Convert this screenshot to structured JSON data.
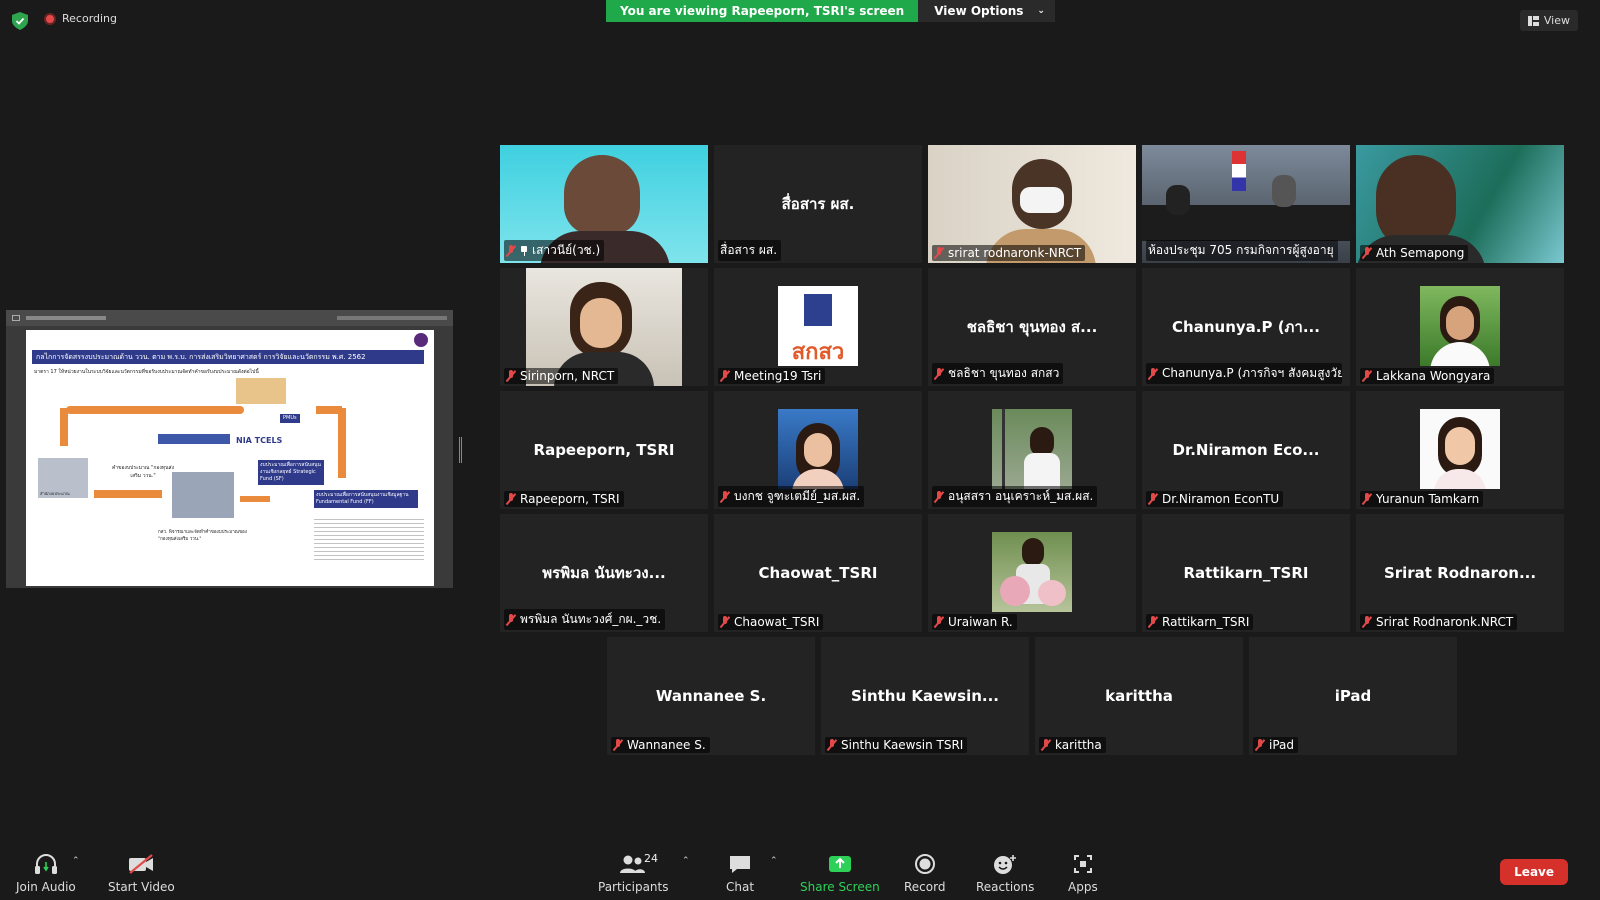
{
  "header": {
    "recording_label": "Recording",
    "viewing_banner": "You are viewing Rapeeporn, TSRI's screen",
    "view_options_label": "View Options",
    "view_label": "View"
  },
  "shared_screen": {
    "slide_title": "กลไกการจัดสรรงบประมาณด้าน ววน. ตาม พ.ร.บ. การส่งเสริมวิทยาศาสตร์ การวิจัยและนวัตกรรม พ.ศ. 2562",
    "slide_subtitle": "มาตรา 17 ให้หน่วยงานในระบบวิจัยและนวัตกรรมที่ขอรับงบประมาณจัดทำคำขอรับงบประมาณดังต่อไปนี้",
    "box_pmus": "PMUs",
    "box_sf": "งบประมาณเพื่อการสนับสนุนงานเชิงกลยุทธ์ Strategic Fund (SF)",
    "box_ff": "งบประมาณเพื่อการสนับสนุนงานเชิงมูลฐาน Fundamental Fund (FF)",
    "fund_text": "คำของบประมาณ \"กองทุนส่งเสริม ววน.\"",
    "budget_office": "สำนักงบประมาณ",
    "nia_text": "NIA TCELS",
    "bottom_text": "กสว. พิจารณาและจัดทำคำของบประมาณของ \"กองทุนส่งเสริม ววน.\""
  },
  "gallery": [
    {
      "name": "เสาวนีย์(วช.)",
      "display": "",
      "mic_muted": true,
      "pinned": true,
      "active": false,
      "video": "person-cyan"
    },
    {
      "name": "สื่อสาร ผส.",
      "display": "สื่อสาร ผส.",
      "mic_muted": false,
      "pinned": false,
      "active": false,
      "video": ""
    },
    {
      "name": "srirat rodnaronk-NRCT",
      "display": "",
      "mic_muted": true,
      "pinned": false,
      "active": false,
      "video": "person-mask"
    },
    {
      "name": "ห้องประชุม 705 กรมกิจการผู้สูงอายุ",
      "display": "",
      "mic_muted": false,
      "pinned": false,
      "active": true,
      "video": "meeting-room"
    },
    {
      "name": "Ath Semapong",
      "display": "",
      "mic_muted": true,
      "pinned": false,
      "active": false,
      "video": "person-teal"
    },
    {
      "name": "Sirinporn, NRCT",
      "display": "",
      "mic_muted": true,
      "pinned": false,
      "active": false,
      "video": "person-white"
    },
    {
      "name": "Meeting19 Tsri",
      "display": "",
      "mic_muted": true,
      "pinned": false,
      "active": false,
      "video": "logo-sksw",
      "logo_text": "สกสว"
    },
    {
      "name": "ชลธิชา ขุนทอง สกสว",
      "display": "ชลธิชา ขุนทอง ส...",
      "mic_muted": true,
      "pinned": false,
      "active": false,
      "video": ""
    },
    {
      "name": "Chanunya.P (ภารกิจฯ สังคมสูงวัย...",
      "display": "Chanunya.P  (ภา...",
      "mic_muted": true,
      "pinned": false,
      "active": false,
      "video": ""
    },
    {
      "name": "Lakkana Wongyara",
      "display": "",
      "mic_muted": true,
      "pinned": false,
      "active": false,
      "video": "avatar-green"
    },
    {
      "name": "Rapeeporn, TSRI",
      "display": "Rapeeporn, TSRI",
      "mic_muted": true,
      "pinned": false,
      "active": false,
      "video": ""
    },
    {
      "name": "บงกช จูฑะเตมีย์_มส.ผส.",
      "display": "",
      "mic_muted": true,
      "pinned": false,
      "active": false,
      "video": "avatar-sea"
    },
    {
      "name": "อนุสสรา อนุเคราะห์_มส.ผส.",
      "display": "",
      "mic_muted": true,
      "pinned": false,
      "active": false,
      "video": "avatar-park"
    },
    {
      "name": "Dr.Niramon EconTU",
      "display": "Dr.Niramon  Eco...",
      "mic_muted": true,
      "pinned": false,
      "active": false,
      "video": ""
    },
    {
      "name": "Yuranun Tamkarn",
      "display": "",
      "mic_muted": true,
      "pinned": false,
      "active": false,
      "video": "avatar-white"
    },
    {
      "name": "พรพิมล นันทะวงศ์_กผ._วช.",
      "display": "พรพิมล นันทะวง...",
      "mic_muted": true,
      "pinned": false,
      "active": false,
      "video": ""
    },
    {
      "name": "Chaowat_TSRI",
      "display": "Chaowat_TSRI",
      "mic_muted": true,
      "pinned": false,
      "active": false,
      "video": ""
    },
    {
      "name": "Uraiwan R.",
      "display": "",
      "mic_muted": true,
      "pinned": false,
      "active": false,
      "video": "avatar-flowers"
    },
    {
      "name": "Rattikarn_TSRI",
      "display": "Rattikarn_TSRI",
      "mic_muted": true,
      "pinned": false,
      "active": false,
      "video": ""
    },
    {
      "name": "Srirat Rodnaronk.NRCT",
      "display": "Srirat  Rodnaron...",
      "mic_muted": true,
      "pinned": false,
      "active": false,
      "video": ""
    },
    {
      "name": "Wannanee S.",
      "display": "Wannanee S.",
      "mic_muted": true,
      "pinned": false,
      "active": false,
      "video": ""
    },
    {
      "name": "Sinthu Kaewsin TSRI",
      "display": "Sinthu  Kaewsin...",
      "mic_muted": true,
      "pinned": false,
      "active": false,
      "video": ""
    },
    {
      "name": "karittha",
      "display": "karittha",
      "mic_muted": true,
      "pinned": false,
      "active": false,
      "video": ""
    },
    {
      "name": "iPad",
      "display": "iPad",
      "mic_muted": true,
      "pinned": false,
      "active": false,
      "video": ""
    }
  ],
  "toolbar": {
    "join_audio": "Join Audio",
    "start_video": "Start Video",
    "participants": "Participants",
    "participants_count": "24",
    "chat": "Chat",
    "share_screen": "Share Screen",
    "record": "Record",
    "reactions": "Reactions",
    "apps": "Apps",
    "leave": "Leave"
  },
  "colors": {
    "banner_green": "#1fa94a",
    "active_border": "#d9e86a",
    "mic_muted_red": "#e24a4a",
    "leave_red": "#d6302b",
    "share_green": "#2ed158"
  }
}
